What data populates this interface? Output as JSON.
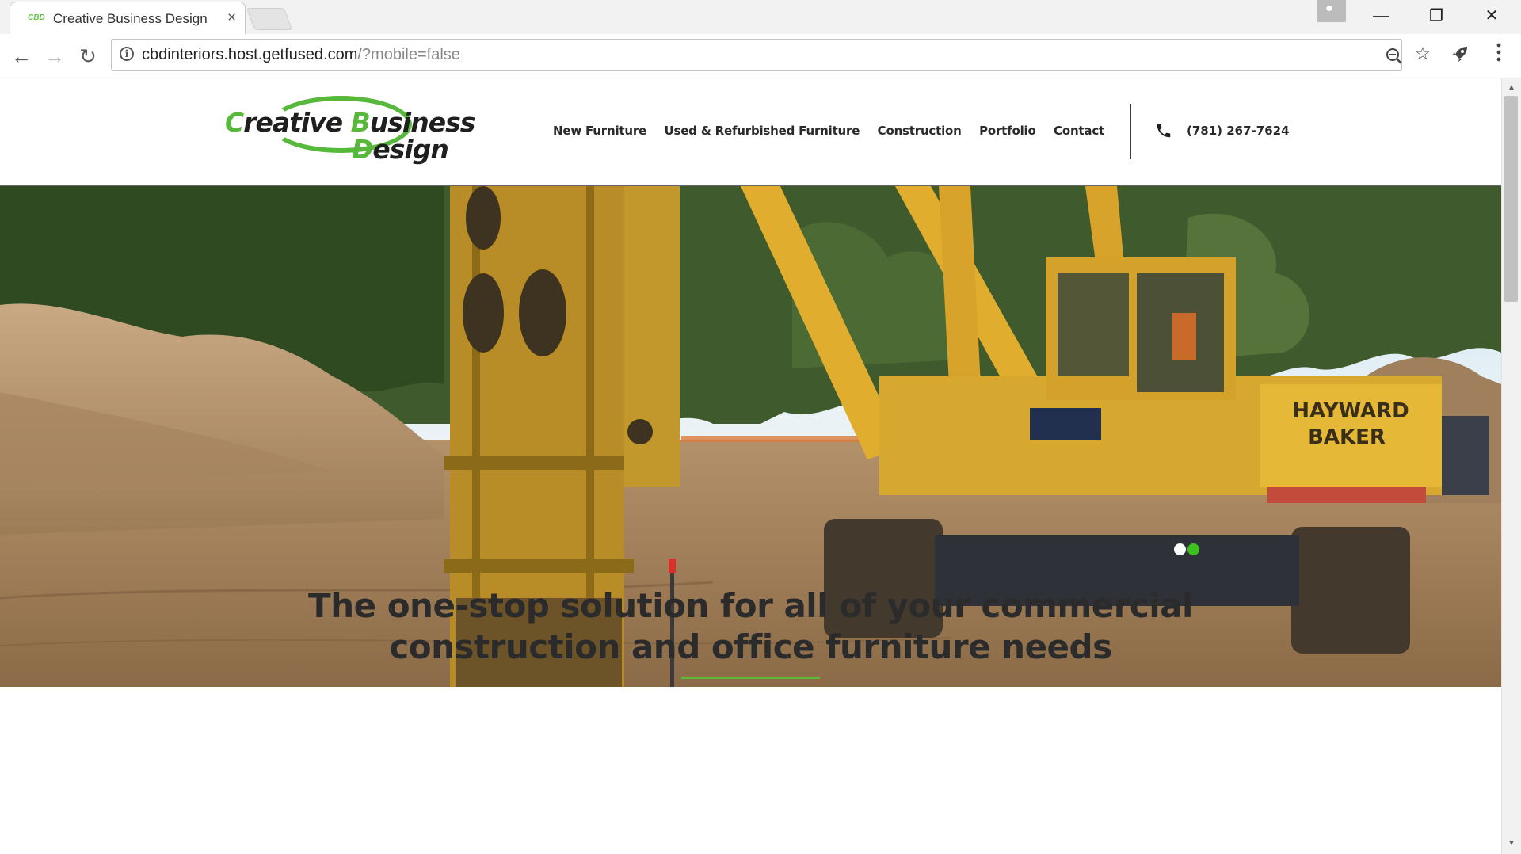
{
  "browser": {
    "tab_favicon_text": "CBD",
    "tab_title": "Creative Business Design",
    "tab_close": "×",
    "url_host": "cbdinteriors.host.getfused.com",
    "url_path": "/?mobile=false",
    "icons": {
      "back": "back-arrow-icon",
      "forward": "forward-arrow-icon",
      "reload": "reload-icon",
      "info": "info-icon",
      "zoom": "zoom-icon",
      "bookmark": "star-icon",
      "extension": "rocket-icon",
      "menu": "kebab-menu-icon",
      "profile": "profile-icon"
    },
    "window_controls": {
      "minimize": "—",
      "restore": "❐",
      "close": "✕"
    }
  },
  "site": {
    "logo": {
      "line1_a": "C",
      "line1_b": "reative ",
      "line1_c": "B",
      "line1_d": "usiness",
      "line2_a": "D",
      "line2_b": "esign"
    },
    "nav": [
      {
        "label": "New Furniture"
      },
      {
        "label": "Used & Refurbished Furniture"
      },
      {
        "label": "Construction"
      },
      {
        "label": "Portfolio"
      },
      {
        "label": "Contact"
      }
    ],
    "phone": "(781) 267-7624",
    "colors": {
      "brand_green": "#57b83b",
      "text_dark": "#2b2b2b"
    }
  },
  "hero": {
    "slides_total": 2,
    "active_slide": 2,
    "machine_text_1": "HAYWARD",
    "machine_text_2": "BAKER"
  },
  "headline": {
    "line1": "The one-stop solution for all of your commercial",
    "line2": "construction and office furniture needs"
  }
}
